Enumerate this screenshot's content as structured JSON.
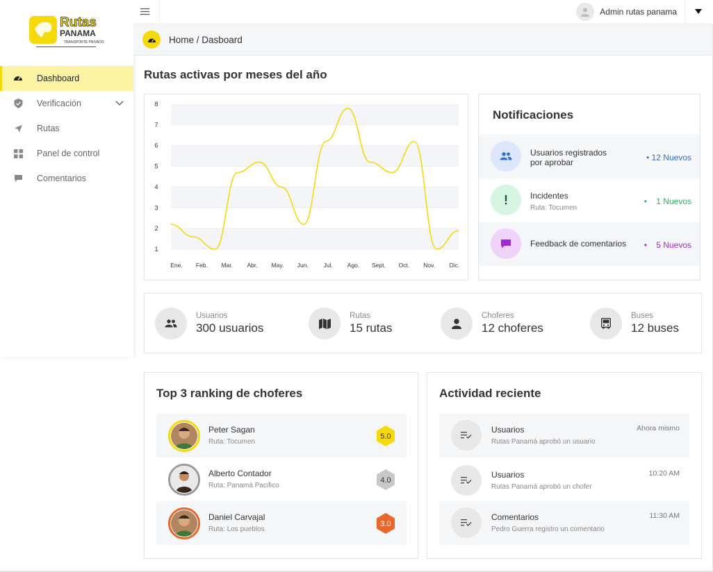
{
  "brand": {
    "name": "Rutas PANAMA",
    "tagline": "TRANSPORTE PRIVADO",
    "accent": "#f5d90a"
  },
  "sidebar": {
    "items": [
      {
        "label": "Dashboard",
        "icon": "gauge-icon",
        "active": true
      },
      {
        "label": "Verificación",
        "icon": "shield-check-icon"
      },
      {
        "label": "Rutas",
        "icon": "navigation-arrow-icon"
      },
      {
        "label": "Panel de control",
        "icon": "grid-icon"
      },
      {
        "label": "Comentarios",
        "icon": "comment-icon"
      }
    ]
  },
  "topbar": {
    "user_name": "Admin rutas panama"
  },
  "breadcrumb": {
    "text": "Home / Dasboard"
  },
  "page_title": "Rutas activas por meses del año",
  "chart_data": {
    "type": "line",
    "categories": [
      "Ene.",
      "Feb.",
      "Mar.",
      "Abr.",
      "May.",
      "Jun.",
      "Jul.",
      "Ago.",
      "Sept.",
      "Oct.",
      "Nov.",
      "Dic."
    ],
    "values": [
      2.2,
      1.6,
      1.0,
      4.7,
      5.2,
      4.0,
      2.2,
      6.2,
      7.8,
      5.2,
      4.7,
      6.2,
      1.0,
      1.9
    ],
    "y_ticks": [
      1,
      2,
      3,
      4,
      5,
      6,
      7,
      8
    ],
    "ylim": [
      1,
      8
    ],
    "line_color": "#f5d90a",
    "grid": "alternating horizontal bands"
  },
  "notifications": {
    "title": "Notificaciones",
    "items": [
      {
        "label_line1": "Usuarios registrados",
        "label_line2": "por aprobar",
        "sub": "",
        "count": "• 12 Nuevos",
        "color": "#2f6fd6",
        "bg": "#dde6fb",
        "icon": "users-icon"
      },
      {
        "label_line1": "Incidentes",
        "label_line2": "",
        "sub": "Ruta: Tocumen",
        "count": "•    1 Nuevos",
        "color": "#22b35a",
        "bg": "#d6f5e2",
        "icon": "exclamation-icon"
      },
      {
        "label_line1": "Feedback de comentarios",
        "label_line2": "",
        "sub": "",
        "count": "•    5 Nuevos",
        "color": "#a326d9",
        "bg": "#efd3fa",
        "icon": "message-icon"
      }
    ]
  },
  "stats": [
    {
      "label": "Usuarios",
      "value": "300 usuarios",
      "icon": "users-icon"
    },
    {
      "label": "Rutas",
      "value": "15 rutas",
      "icon": "map-icon"
    },
    {
      "label": "Choferes",
      "value": "12 choferes",
      "icon": "person-icon"
    },
    {
      "label": "Buses",
      "value": "12 buses",
      "icon": "bus-icon"
    }
  ],
  "ranking": {
    "title": "Top 3 ranking de choferes",
    "items": [
      {
        "name": "Peter Sagan",
        "route": "Ruta: Tocumen",
        "score": "5.0",
        "ring": "#f5d90a",
        "hex": "#f5d90a",
        "hex_text": "#333"
      },
      {
        "name": "Alberto Contador",
        "route": "Ruta: Panamá Pacifico",
        "score": "4.0",
        "ring": "#9a9a9a",
        "hex": "#c8c8c8",
        "hex_text": "#333"
      },
      {
        "name": "Daniel Carvajal",
        "route": "Ruta: Los pueblos",
        "score": "3.0",
        "ring": "#e8672a",
        "hex": "#e8672a",
        "hex_text": "#fff"
      }
    ]
  },
  "activity": {
    "title": "Actividad reciente",
    "items": [
      {
        "title": "Usuarios",
        "desc": "Rutas Panamá aprobó un usuario",
        "time": "Ahora mismo"
      },
      {
        "title": "Usuarios",
        "desc": "Rutas Panamá aprobó un chofer",
        "time": "10:20 AM"
      },
      {
        "title": "Comentarios",
        "desc": "Pedro Guerra registro un comentario",
        "time": "11:30 AM"
      }
    ]
  }
}
